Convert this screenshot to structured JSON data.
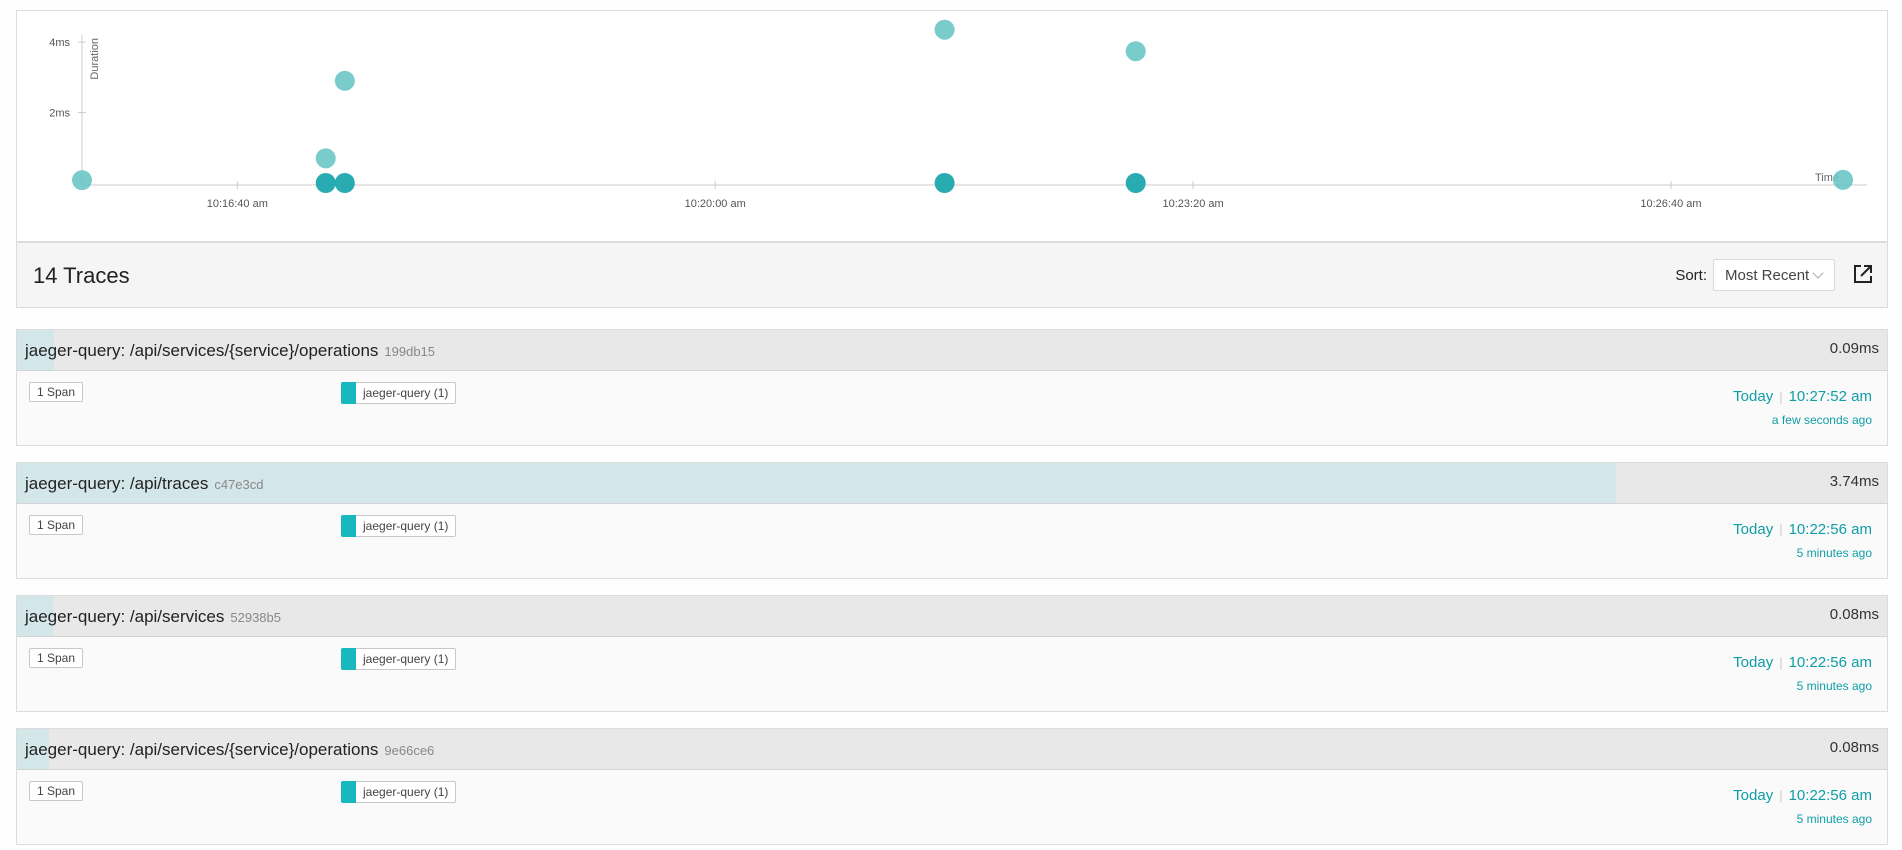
{
  "chart_data": {
    "type": "scatter",
    "ylabel": "Duration",
    "xlabel": "Time",
    "y_ticks": [
      "2ms",
      "4ms"
    ],
    "x_ticks": [
      "10:16:40 am",
      "10:20:00 am",
      "10:23:20 am",
      "10:26:40 am"
    ],
    "ylim_ms": [
      0,
      4.2
    ],
    "xlim": [
      "10:15:35 am",
      "10:27:52 am"
    ],
    "points": [
      {
        "time": "10:15:35 am",
        "duration_ms": 0.08
      },
      {
        "time": "10:17:17 am",
        "duration_ms": 0.7
      },
      {
        "time": "10:17:17 am",
        "duration_ms": 0.0
      },
      {
        "time": "10:17:25 am",
        "duration_ms": 2.9
      },
      {
        "time": "10:17:25 am",
        "duration_ms": 0.0
      },
      {
        "time": "10:21:36 am",
        "duration_ms": 4.35
      },
      {
        "time": "10:21:36 am",
        "duration_ms": 0.0
      },
      {
        "time": "10:22:56 am",
        "duration_ms": 3.74
      },
      {
        "time": "10:22:56 am",
        "duration_ms": 0.0
      },
      {
        "time": "10:27:52 am",
        "duration_ms": 0.09
      }
    ],
    "colors": {
      "light": "#6cc5c7",
      "dark": "#1ea8ad"
    }
  },
  "results": {
    "count_title": "14 Traces",
    "sort_label": "Sort:",
    "sort_value": "Most Recent",
    "open_icon": "external-open-icon"
  },
  "traces": [
    {
      "title": "jaeger-query: /api/services/{service}/operations",
      "id": "199db15",
      "duration": "0.09ms",
      "duration_fraction": 0.02,
      "spans": "1 Span",
      "service": "jaeger-query (1)",
      "day": "Today",
      "time": "10:27:52 am",
      "ago": "a few seconds ago"
    },
    {
      "title": "jaeger-query: /api/traces",
      "id": "c47e3cd",
      "duration": "3.74ms",
      "duration_fraction": 0.855,
      "spans": "1 Span",
      "service": "jaeger-query (1)",
      "day": "Today",
      "time": "10:22:56 am",
      "ago": "5 minutes ago"
    },
    {
      "title": "jaeger-query: /api/services",
      "id": "52938b5",
      "duration": "0.08ms",
      "duration_fraction": 0.019,
      "spans": "1 Span",
      "service": "jaeger-query (1)",
      "day": "Today",
      "time": "10:22:56 am",
      "ago": "5 minutes ago"
    },
    {
      "title": "jaeger-query: /api/services/{service}/operations",
      "id": "9e66ce6",
      "duration": "0.08ms",
      "duration_fraction": 0.017,
      "spans": "1 Span",
      "service": "jaeger-query (1)",
      "day": "Today",
      "time": "10:22:56 am",
      "ago": "5 minutes ago"
    }
  ]
}
